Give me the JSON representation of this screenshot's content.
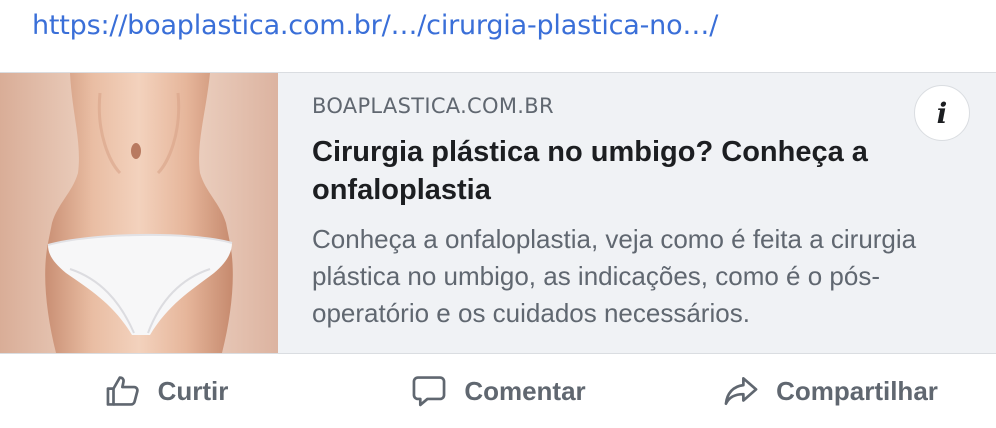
{
  "post": {
    "url_text": "https://boaplastica.com.br/…/cirurgia-plastica-no…/"
  },
  "link_card": {
    "domain": "BOAPLASTICA.COM.BR",
    "headline": "Cirurgia plástica no umbigo? Conheça a onfaloplastia",
    "description": "Conheça a onfaloplastia, veja como é feita a cirurgia plástica no umbigo, as indicações, como é o pós-operatório e os cuidados necessários.",
    "info_icon_glyph": "i",
    "thumbnail_icon": "torso-photo"
  },
  "actions": {
    "like_label": "Curtir",
    "like_icon": "thumbs-up-icon",
    "comment_label": "Comentar",
    "comment_icon": "speech-bubble-icon",
    "share_label": "Compartilhar",
    "share_icon": "share-arrow-icon"
  },
  "colors": {
    "link": "#3a6fd8",
    "card_background": "#f0f2f5",
    "muted_text": "#606770",
    "headline_text": "#1c1e21"
  }
}
